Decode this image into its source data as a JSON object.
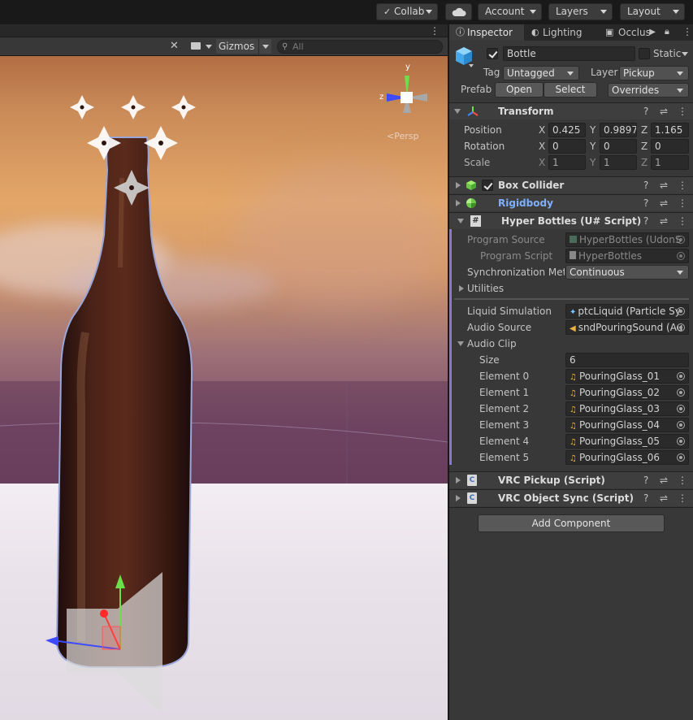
{
  "toolbar": {
    "collab_label": "Collab",
    "account_label": "Account",
    "layers_label": "Layers",
    "layout_label": "Layout"
  },
  "scene": {
    "gizmos_label": "Gizmos",
    "search_placeholder": "All",
    "persp_label": "Persp",
    "axis_y": "y",
    "axis_z": "z"
  },
  "inspector": {
    "tabs": [
      {
        "label": "Inspector"
      },
      {
        "label": "Lighting"
      },
      {
        "label": "Occlus"
      }
    ],
    "object": {
      "name": "Bottle",
      "static_label": "Static",
      "tag_label": "Tag",
      "tag_value": "Untagged",
      "layer_label": "Layer",
      "layer_value": "Pickup",
      "prefab_label": "Prefab",
      "open_label": "Open",
      "select_label": "Select",
      "overrides_label": "Overrides"
    },
    "transform": {
      "title": "Transform",
      "position_label": "Position",
      "rotation_label": "Rotation",
      "scale_label": "Scale",
      "x": "X",
      "y": "Y",
      "z": "Z",
      "position": [
        "0.425",
        "0.9897",
        "1.165"
      ],
      "rotation": [
        "0",
        "0",
        "0"
      ],
      "scale": [
        "1",
        "1",
        "1"
      ]
    },
    "box_collider": {
      "title": "Box Collider"
    },
    "rigidbody": {
      "title": "Rigidbody"
    },
    "hyper_bottles": {
      "title": "Hyper Bottles (U# Script)",
      "program_source_label": "Program Source",
      "program_source_value": "HyperBottles (UdonS",
      "program_script_label": "Program Script",
      "program_script_value": "HyperBottles",
      "sync_label": "Synchronization Metl",
      "sync_value": "Continuous",
      "utilities_label": "Utilities",
      "liquid_label": "Liquid Simulation",
      "liquid_value": "ptcLiquid (Particle Sy",
      "audio_source_label": "Audio Source",
      "audio_source_value": "sndPouringSound (Au",
      "audio_clip_label": "Audio Clip",
      "size_label": "Size",
      "size_value": "6",
      "elements": [
        {
          "label": "Element 0",
          "value": "PouringGlass_01"
        },
        {
          "label": "Element 1",
          "value": "PouringGlass_02"
        },
        {
          "label": "Element 2",
          "value": "PouringGlass_03"
        },
        {
          "label": "Element 3",
          "value": "PouringGlass_04"
        },
        {
          "label": "Element 4",
          "value": "PouringGlass_05"
        },
        {
          "label": "Element 5",
          "value": "PouringGlass_06"
        }
      ]
    },
    "vrc_pickup": {
      "title": "VRC Pickup (Script)"
    },
    "vrc_object_sync": {
      "title": "VRC Object Sync (Script)"
    },
    "add_component_label": "Add Component"
  },
  "colors": {
    "accent_blue": "#3d88ff",
    "rigidbody_title": "#7fb0ff",
    "script_bar": "#8a78c8"
  }
}
